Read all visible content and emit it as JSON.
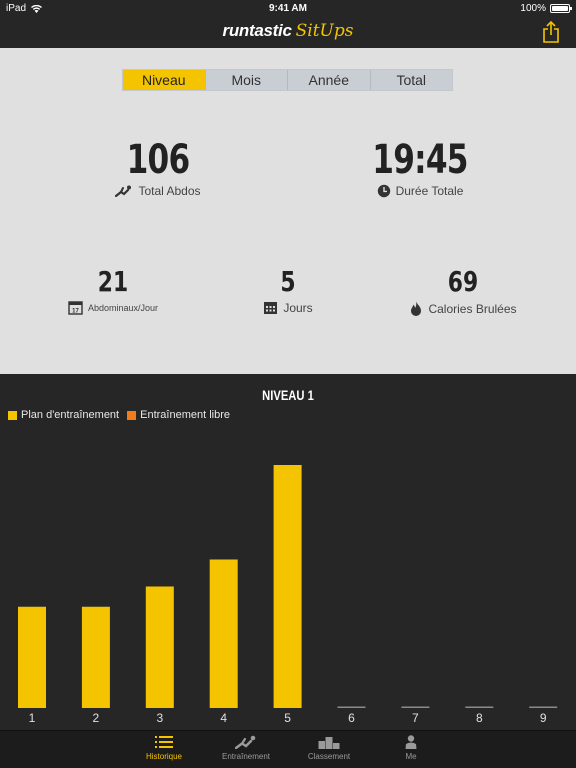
{
  "status_bar": {
    "device": "iPad",
    "time": "9:41 AM",
    "battery": "100%"
  },
  "app": {
    "brand_primary": "runtastic",
    "brand_secondary": "SitUps"
  },
  "tabs_period": [
    {
      "label": "Niveau",
      "active": true
    },
    {
      "label": "Mois",
      "active": false
    },
    {
      "label": "Année",
      "active": false
    },
    {
      "label": "Total",
      "active": false
    }
  ],
  "stats": {
    "total_abdos": {
      "value": "106",
      "label": "Total Abdos"
    },
    "duree_totale": {
      "value": "19:45",
      "label": "Durée Totale"
    },
    "abdos_jour": {
      "value": "21",
      "label": "Abdominaux/Jour"
    },
    "jours": {
      "value": "5",
      "label": "Jours"
    },
    "calories": {
      "value": "69",
      "label": "Calories Brulées"
    }
  },
  "chart_data": {
    "type": "bar",
    "title": "NIVEAU 1",
    "legend": [
      {
        "name": "Plan d'entraînement",
        "color": "#f5c400"
      },
      {
        "name": "Entraînement libre",
        "color": "#f07d1a"
      }
    ],
    "categories": [
      "1",
      "2",
      "3",
      "4",
      "5",
      "6",
      "7",
      "8",
      "9"
    ],
    "series": [
      {
        "name": "Plan d'entraînement",
        "values": [
          15,
          15,
          18,
          22,
          36,
          0,
          0,
          0,
          0
        ]
      }
    ],
    "ylim": [
      0,
      40
    ],
    "colors": {
      "bar": "#f5c400",
      "empty": "#8a8a8a"
    }
  },
  "tab_bar": [
    {
      "label": "Historique",
      "active": true,
      "icon": "list-icon"
    },
    {
      "label": "Entraînement",
      "active": false,
      "icon": "situp-icon"
    },
    {
      "label": "Classement",
      "active": false,
      "icon": "podium-icon"
    },
    {
      "label": "Me",
      "active": false,
      "icon": "person-icon"
    }
  ]
}
